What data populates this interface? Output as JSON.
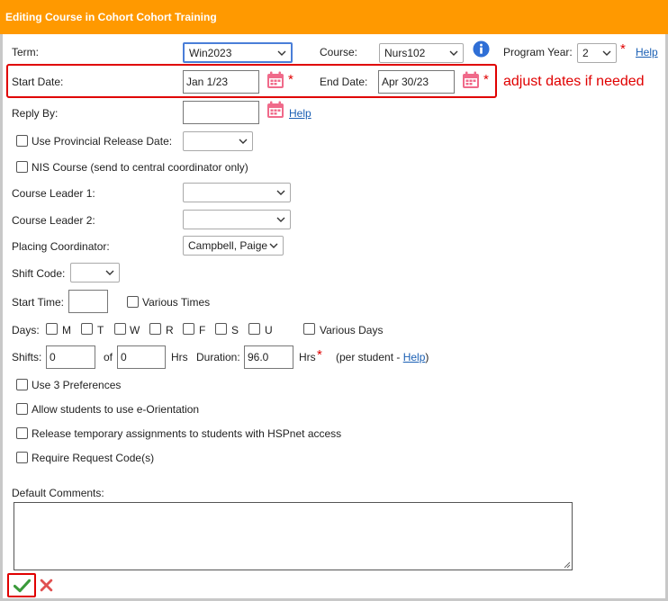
{
  "header": {
    "title": "Editing Course in Cohort Cohort Training"
  },
  "row1": {
    "term_label": "Term:",
    "term_value": "Win2023",
    "course_label": "Course:",
    "course_value": "Nurs102",
    "program_year_label": "Program Year:",
    "program_year_value": "2",
    "required_mark": "*",
    "help": "Help"
  },
  "dates": {
    "start_label": "Start Date:",
    "start_value": "Jan 1/23",
    "end_label": "End Date:",
    "end_value": "Apr 30/23",
    "required_mark": "*",
    "note": "adjust dates if needed"
  },
  "reply": {
    "label": "Reply By:",
    "value": "",
    "help": "Help"
  },
  "provincial": {
    "label": "Use Provincial Release Date:",
    "value": ""
  },
  "nis": {
    "label": "NIS Course (send to central coordinator only)"
  },
  "leaders": {
    "leader1_label": "Course Leader 1:",
    "leader1_value": "",
    "leader2_label": "Course Leader 2:",
    "leader2_value": ""
  },
  "placing": {
    "label": "Placing Coordinator:",
    "value": "Campbell, Paige"
  },
  "shift_code": {
    "label": "Shift Code:",
    "value": ""
  },
  "start_time": {
    "label": "Start Time:",
    "value": "",
    "various_label": "Various Times"
  },
  "days": {
    "label": "Days:",
    "items": [
      "M",
      "T",
      "W",
      "R",
      "F",
      "S",
      "U"
    ],
    "various_label": "Various Days"
  },
  "shifts": {
    "label": "Shifts:",
    "value": "0",
    "of_label": "of",
    "hours_value": "0",
    "hrs_label": "Hrs",
    "duration_label": "Duration:",
    "duration_value": "96.0",
    "hrs2_label": "Hrs",
    "required_mark": "*",
    "per_student_prefix": "(per student -",
    "help": "Help",
    "per_student_suffix": ")"
  },
  "options": {
    "three_prefs": "Use 3 Preferences",
    "eorientation": "Allow students to use e-Orientation",
    "release_temp": "Release temporary assignments to students with HSPnet access",
    "request_code": "Require Request Code(s)"
  },
  "comments": {
    "label": "Default Comments:",
    "value": ""
  },
  "colors": {
    "header": "#ff9900",
    "accent_red": "#e00000",
    "calendar": "#f06a8a",
    "confirm_green": "#3a9a3a",
    "cancel_red": "#e05050",
    "link": "#1a5fb4"
  },
  "icons": [
    "calendar-icon",
    "info-icon",
    "chevron-down-icon",
    "checkmark-icon",
    "close-icon"
  ]
}
